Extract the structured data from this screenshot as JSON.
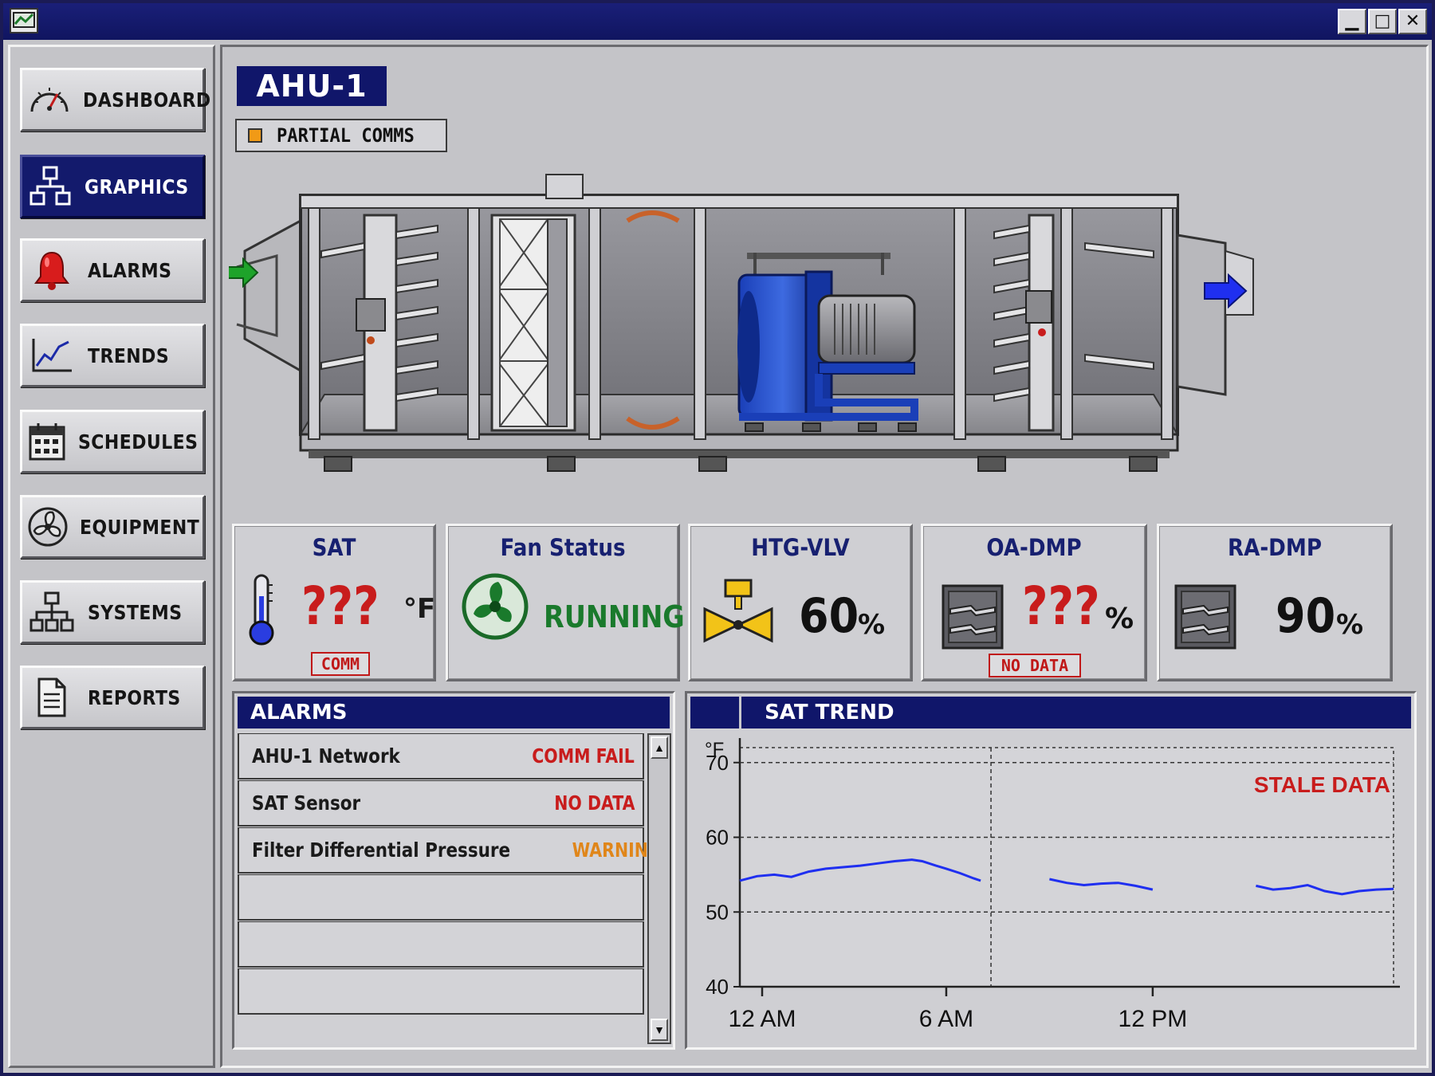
{
  "window": {
    "minimize": "▁",
    "maximize": "□",
    "close": "✕"
  },
  "nav": [
    {
      "label": "DASHBOARD",
      "icon": "gauge-icon",
      "active": false
    },
    {
      "label": "GRAPHICS",
      "icon": "network-icon",
      "active": true
    },
    {
      "label": "ALARMS",
      "icon": "bell-icon",
      "active": false
    },
    {
      "label": "TRENDS",
      "icon": "trend-line-icon",
      "active": false
    },
    {
      "label": "SCHEDULES",
      "icon": "calendar-icon",
      "active": false
    },
    {
      "label": "EQUIPMENT",
      "icon": "fan-icon",
      "active": false
    },
    {
      "label": "SYSTEMS",
      "icon": "hierarchy-icon",
      "active": false
    },
    {
      "label": "REPORTS",
      "icon": "document-icon",
      "active": false
    }
  ],
  "unit": {
    "title": "AHU-1",
    "comm_status": "PARTIAL COMMS",
    "comm_color": "#f19a16"
  },
  "tiles": {
    "sat": {
      "title": "SAT",
      "value": "???",
      "unit": "°F",
      "tag": "COMM"
    },
    "fan": {
      "title": "Fan Status",
      "value": "RUNNING"
    },
    "htg": {
      "title": "HTG-VLV",
      "value": "60",
      "unit": "%"
    },
    "oa": {
      "title": "OA-DMP",
      "value": "???",
      "unit": "%",
      "tag": "NO DATA"
    },
    "ra": {
      "title": "RA-DMP",
      "value": "90",
      "unit": "%"
    }
  },
  "alarms": {
    "title": "ALARMS",
    "rows": [
      {
        "name": "AHU-1 Network",
        "state": "COMM FAIL",
        "color": "#c81c1c"
      },
      {
        "name": "SAT Sensor",
        "state": "NO DATA",
        "color": "#c81c1c"
      },
      {
        "name": "Filter Differential Pressure",
        "state": "WARNING",
        "color": "#e0861a"
      },
      {
        "name": "",
        "state": "",
        "color": "#000"
      },
      {
        "name": "",
        "state": "",
        "color": "#000"
      },
      {
        "name": "",
        "state": "",
        "color": "#000"
      }
    ],
    "scroll_up": "▲",
    "scroll_down": "▼"
  },
  "trend": {
    "title": "SAT TREND",
    "stale_label": "STALE DATA"
  },
  "chart_data": {
    "type": "line",
    "ylabel": "°F",
    "ylim": [
      40,
      72
    ],
    "yticks": [
      40,
      50,
      60,
      70
    ],
    "xlim": [
      0,
      19
    ],
    "xticks": [
      {
        "x": 0,
        "label": "12 AM"
      },
      {
        "x": 6,
        "label": "6 AM"
      },
      {
        "x": 12,
        "label": "12 PM"
      }
    ],
    "series": [
      {
        "segments": [
          [
            [
              0,
              54.2
            ],
            [
              0.5,
              54.8
            ],
            [
              1,
              55.0
            ],
            [
              1.5,
              54.7
            ],
            [
              2,
              55.4
            ],
            [
              2.5,
              55.8
            ],
            [
              3,
              56.0
            ],
            [
              3.5,
              56.2
            ],
            [
              4,
              56.5
            ],
            [
              4.5,
              56.8
            ],
            [
              5,
              57.0
            ],
            [
              5.3,
              56.8
            ],
            [
              5.7,
              56.2
            ],
            [
              6,
              55.8
            ],
            [
              6.4,
              55.2
            ],
            [
              6.8,
              54.5
            ],
            [
              7,
              54.2
            ]
          ],
          [
            [
              9,
              54.4
            ],
            [
              9.5,
              53.9
            ],
            [
              10,
              53.6
            ],
            [
              10.5,
              53.8
            ],
            [
              11,
              53.9
            ],
            [
              11.5,
              53.5
            ],
            [
              12,
              53.0
            ]
          ],
          [
            [
              15,
              53.5
            ],
            [
              15.5,
              53.0
            ],
            [
              16,
              53.2
            ],
            [
              16.5,
              53.6
            ],
            [
              17,
              52.8
            ],
            [
              17.5,
              52.4
            ],
            [
              18,
              52.8
            ],
            [
              18.5,
              53.0
            ],
            [
              19,
              53.1
            ]
          ]
        ]
      }
    ],
    "grid": true
  }
}
